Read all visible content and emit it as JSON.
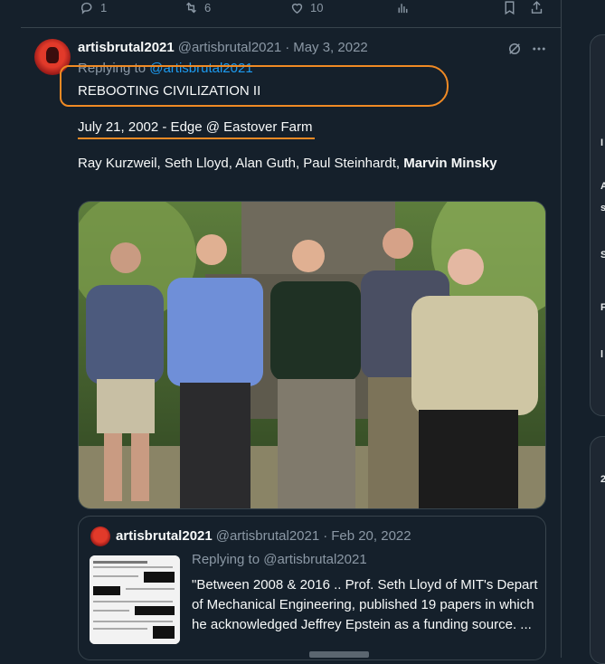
{
  "actions_top": {
    "reply_count": "1",
    "retweet_count": "6",
    "like_count": "10"
  },
  "tweet": {
    "display_name": "artisbrutal2021",
    "handle": "@artisbrutal2021",
    "separator": "·",
    "date": "May 3, 2022",
    "replying_prefix": "Replying to",
    "replying_handle": "@artisbrutal2021",
    "line1": "REBOOTING CIVILIZATION II",
    "line2": "July 21, 2002 - Edge @ Eastover Farm",
    "line3_plain": "Ray Kurzweil, Seth Lloyd, Alan Guth, Paul Steinhardt,",
    "line3_bold": "Marvin Minsky"
  },
  "quote": {
    "display_name": "artisbrutal2021",
    "handle": "@artisbrutal2021",
    "separator": "·",
    "date": "Feb 20, 2022",
    "replying": "Replying to @artisbrutal2021",
    "text": "\"Between 2008 & 2016 .. Prof. Seth Lloyd of MIT's Depart of Mechanical Engineering, published 19 papers in which he acknowledged Jeffrey Epstein as a funding source. ..."
  },
  "right_fragments": [
    "I",
    "A",
    "s",
    "S",
    "F",
    "l",
    "2"
  ]
}
